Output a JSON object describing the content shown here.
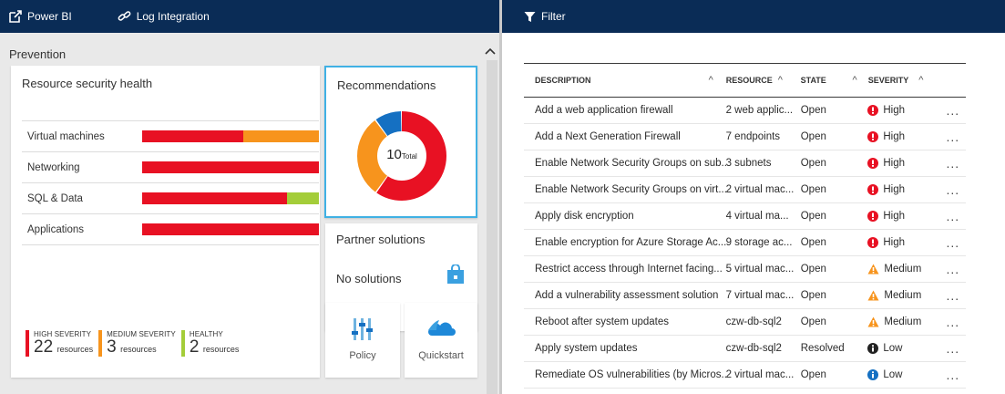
{
  "topbar_left": {
    "powerbi_label": "Power BI",
    "log_label": "Log Integration"
  },
  "topbar_right": {
    "filter_label": "Filter"
  },
  "prevention": {
    "title": "Prevention",
    "health": {
      "title": "Resource security health",
      "rows": [
        {
          "label": "Virtual machines",
          "segments": [
            {
              "color": "#e81123",
              "frac": 0.57
            },
            {
              "color": "#f7941d",
              "frac": 0.43
            }
          ]
        },
        {
          "label": "Networking",
          "segments": [
            {
              "color": "#e81123",
              "frac": 1.0
            }
          ]
        },
        {
          "label": "SQL & Data",
          "segments": [
            {
              "color": "#e81123",
              "frac": 0.82
            },
            {
              "color": "#a4cd39",
              "frac": 0.18
            }
          ]
        },
        {
          "label": "Applications",
          "segments": [
            {
              "color": "#e81123",
              "frac": 1.0
            }
          ]
        }
      ],
      "legend": [
        {
          "label": "HIGH SEVERITY",
          "count": "22",
          "unit": "resources",
          "color": "#e81123"
        },
        {
          "label": "MEDIUM SEVERITY",
          "count": "3",
          "unit": "resources",
          "color": "#f7941d"
        },
        {
          "label": "HEALTHY",
          "count": "2",
          "unit": "resources",
          "color": "#a4cd39"
        }
      ]
    },
    "recommendations": {
      "title": "Recommendations",
      "total": "10",
      "total_label": "Total",
      "slices": [
        {
          "color": "#e81123",
          "value": 6
        },
        {
          "color": "#f7941d",
          "value": 3
        },
        {
          "color": "#1570c2",
          "value": 1
        }
      ]
    },
    "partners": {
      "title": "Partner solutions",
      "message": "No solutions"
    },
    "tiles": {
      "policy": "Policy",
      "quickstart": "Quickstart"
    }
  },
  "table": {
    "headers": {
      "description": "DESCRIPTION",
      "resource": "RESOURCE",
      "state": "STATE",
      "severity": "SEVERITY"
    },
    "more_glyph": "...",
    "rows": [
      {
        "description": "Add a web application firewall",
        "resource": "2 web applic...",
        "state": "Open",
        "severity": "High"
      },
      {
        "description": "Add a Next Generation Firewall",
        "resource": "7 endpoints",
        "state": "Open",
        "severity": "High"
      },
      {
        "description": "Enable Network Security Groups on sub...",
        "resource": "3 subnets",
        "state": "Open",
        "severity": "High"
      },
      {
        "description": "Enable Network Security Groups on virt...",
        "resource": "2 virtual mac...",
        "state": "Open",
        "severity": "High"
      },
      {
        "description": "Apply disk encryption",
        "resource": "4 virtual ma...",
        "state": "Open",
        "severity": "High"
      },
      {
        "description": "Enable encryption for Azure Storage Ac...",
        "resource": "9 storage ac...",
        "state": "Open",
        "severity": "High"
      },
      {
        "description": "Restrict access through Internet facing...",
        "resource": "5 virtual mac...",
        "state": "Open",
        "severity": "Medium"
      },
      {
        "description": "Add a vulnerability assessment solution",
        "resource": "7 virtual mac...",
        "state": "Open",
        "severity": "Medium"
      },
      {
        "description": "Reboot after system updates",
        "resource": "czw-db-sql2",
        "state": "Open",
        "severity": "Medium"
      },
      {
        "description": "Apply system updates",
        "resource": "czw-db-sql2",
        "state": "Resolved",
        "severity": "Low"
      },
      {
        "description": "Remediate OS vulnerabilities (by Micros...",
        "resource": "2 virtual mac...",
        "state": "Open",
        "severity": "Low"
      }
    ]
  },
  "colors": {
    "topbar": "#0a2c56",
    "high": "#e81123",
    "medium": "#f7941d",
    "healthy": "#a4cd39",
    "accent": "#40b1e4",
    "blue": "#1570c2"
  }
}
